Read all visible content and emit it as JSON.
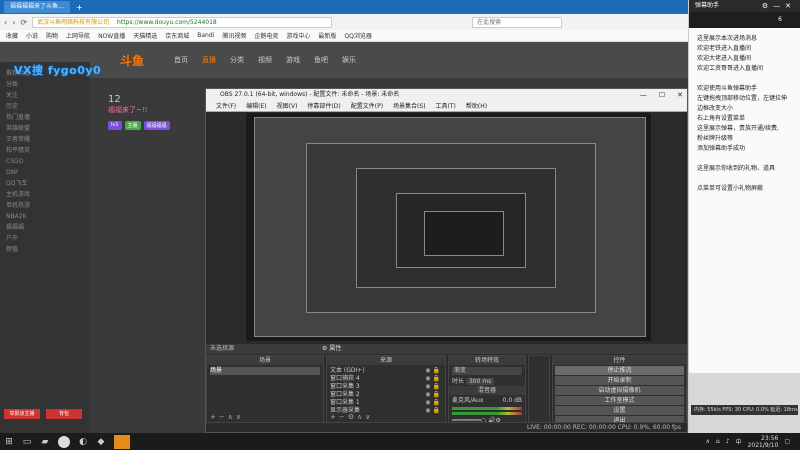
{
  "browser": {
    "tab_title": "福福福福来了斗鱼…",
    "address": "https://www.douyu.com/5244018",
    "address_owner": "武汉斗鱼网络科技有限公司",
    "search_placeholder": "在此搜索",
    "bookmarks": [
      "收藏",
      "小说",
      "购物",
      "上网导航",
      "NOW直播",
      "天猫精选",
      "京东商城",
      "Bandi",
      "腾讯视频",
      "企鹅电竞",
      "游戏中心",
      "最新版",
      "QQ浏览器"
    ]
  },
  "site": {
    "logo": "斗鱼",
    "nav": [
      "首页",
      "直播",
      "分类",
      "视频",
      "游戏",
      "鱼吧",
      "娱乐"
    ],
    "room_title": "福福来了~!!",
    "follow_count": "12",
    "badges": [
      "lv1",
      "主播",
      "福福福福"
    ],
    "watermark": "VX搜 fygo0y0",
    "left_rail": [
      "推荐频道",
      "分类",
      "关注",
      "历史",
      "热门直播",
      "英雄联盟",
      "王者荣耀",
      "和平精英",
      "CSGO",
      "DNF",
      "QQ飞车",
      "主机游戏",
      "单机热游",
      "NBA2K",
      "福福福",
      "户外",
      "颜值"
    ],
    "report_label": "举报该主播",
    "gift_label": "背包"
  },
  "obs": {
    "title": "OBS 27.0.1 (64-bit, windows) - 配置文件: 未命名 - 场景: 未命名",
    "menu": [
      "文件(F)",
      "编辑(E)",
      "视图(V)",
      "停靠部件(D)",
      "配置文件(P)",
      "场景集合(S)",
      "工具(T)",
      "帮助(H)"
    ],
    "preview_caption": "未选择源",
    "docks": {
      "scenes": {
        "title": "场景",
        "items": [
          "场景"
        ]
      },
      "sources": {
        "title": "来源",
        "items": [
          "文本 (GDI+)",
          "窗口捕获 4",
          "窗口采集 3",
          "窗口采集 2",
          "窗口采集 1",
          "显示器采集"
        ]
      },
      "transitions": {
        "title": "转场特效",
        "type": "渐变",
        "duration_label": "时长",
        "duration": "300 ms"
      },
      "mixer": {
        "title": "混音器",
        "track": "麦克风/Aux",
        "level": "0.0 dB"
      },
      "controls": {
        "title": "控件",
        "buttons": [
          "停止推流",
          "开始录制",
          "启动虚拟摄像机",
          "工作室模式",
          "设置",
          "退出"
        ]
      }
    },
    "status": "LIVE: 00:00:00   REC: 00:00:00   CPU: 0.9%, 60.00 fps"
  },
  "side_panel": {
    "title": "弹幕助手",
    "count": "6",
    "messages": [
      "这里展示本次进场消息",
      "欢迎老铁进入直播间",
      "欢迎大佬进入直播间",
      "欢迎工资哥哥进入直播间",
      "",
      "欢迎使用斗鱼弹幕助手",
      "左键拖拽顶部移动位置，左键拉伸",
      "边框改变大小",
      "右上角有设置菜单",
      "这里展示弹幕，贵族开通/续费,",
      "粉丝牌升级等",
      "添加弹幕助手成功",
      "",
      "这里展示你收到的礼物、道具",
      "",
      "点菜单可设置小礼物屏蔽"
    ],
    "bottom_strip": "内存: 55k/s FPS: 30  CPU: 0.0% 延迟: 18ms"
  },
  "taskbar": {
    "time": "23:56",
    "date": "2021/9/10",
    "lang": "中"
  }
}
